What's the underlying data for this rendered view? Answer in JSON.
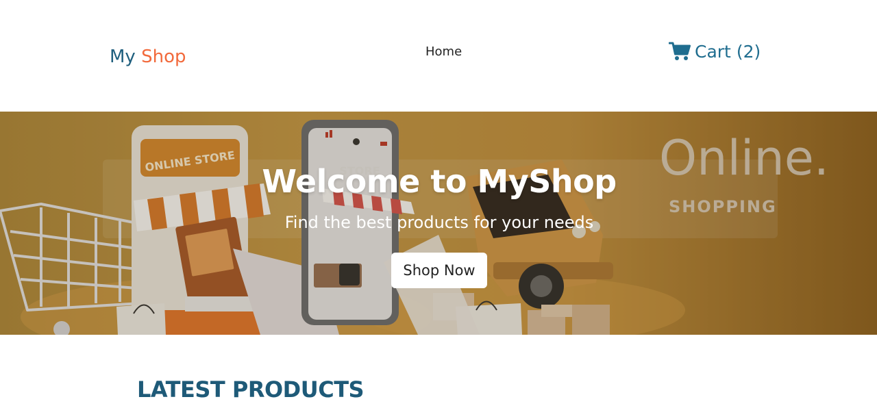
{
  "navbar": {
    "brand_part1": "My",
    "brand_part2": "Shop",
    "home_label": "Home",
    "cart_label": "Cart",
    "cart_count": "(2)",
    "cart_icon": "shopping-cart-icon"
  },
  "hero": {
    "title": "Welcome to MyShop",
    "subtitle": "Find the best products for your needs",
    "button_label": "Shop Now",
    "art": {
      "store_sign": "ONLINE STORE",
      "phone_sign": "STORE",
      "headline": "Online.",
      "tagline": "SHOPPING"
    }
  },
  "latest": {
    "title": "LATEST PRODUCTS"
  },
  "colors": {
    "brand_blue": "#1f5f7e",
    "brand_orange": "#f26a3c",
    "cart_blue": "#1f6d8f",
    "hero_gold": "#c79a47",
    "section_title": "#1e5a78"
  }
}
